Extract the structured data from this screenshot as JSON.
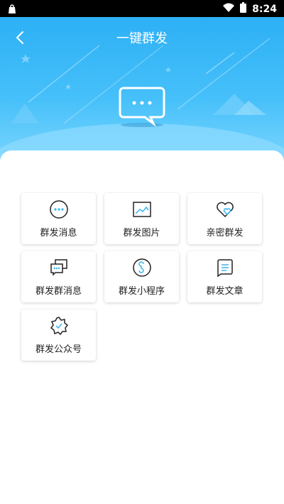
{
  "status_bar": {
    "time": "8:24",
    "icons": [
      "bag-icon",
      "wifi-icon",
      "battery-icon"
    ]
  },
  "header": {
    "title": "一键群发",
    "back_icon": "back-chevron-icon"
  },
  "colors": {
    "accent": "#2db0f5",
    "hero_light": "#7dd6fd"
  },
  "functions": [
    {
      "label": "群发消息",
      "icon": "chat-bubble-icon"
    },
    {
      "label": "群发图片",
      "icon": "image-icon"
    },
    {
      "label": "亲密群发",
      "icon": "heart-icon"
    },
    {
      "label": "群发群消息",
      "icon": "group-chat-icon"
    },
    {
      "label": "群发小程序",
      "icon": "mini-program-icon"
    },
    {
      "label": "群发文章",
      "icon": "article-icon"
    },
    {
      "label": "群发公众号",
      "icon": "official-account-icon"
    }
  ]
}
